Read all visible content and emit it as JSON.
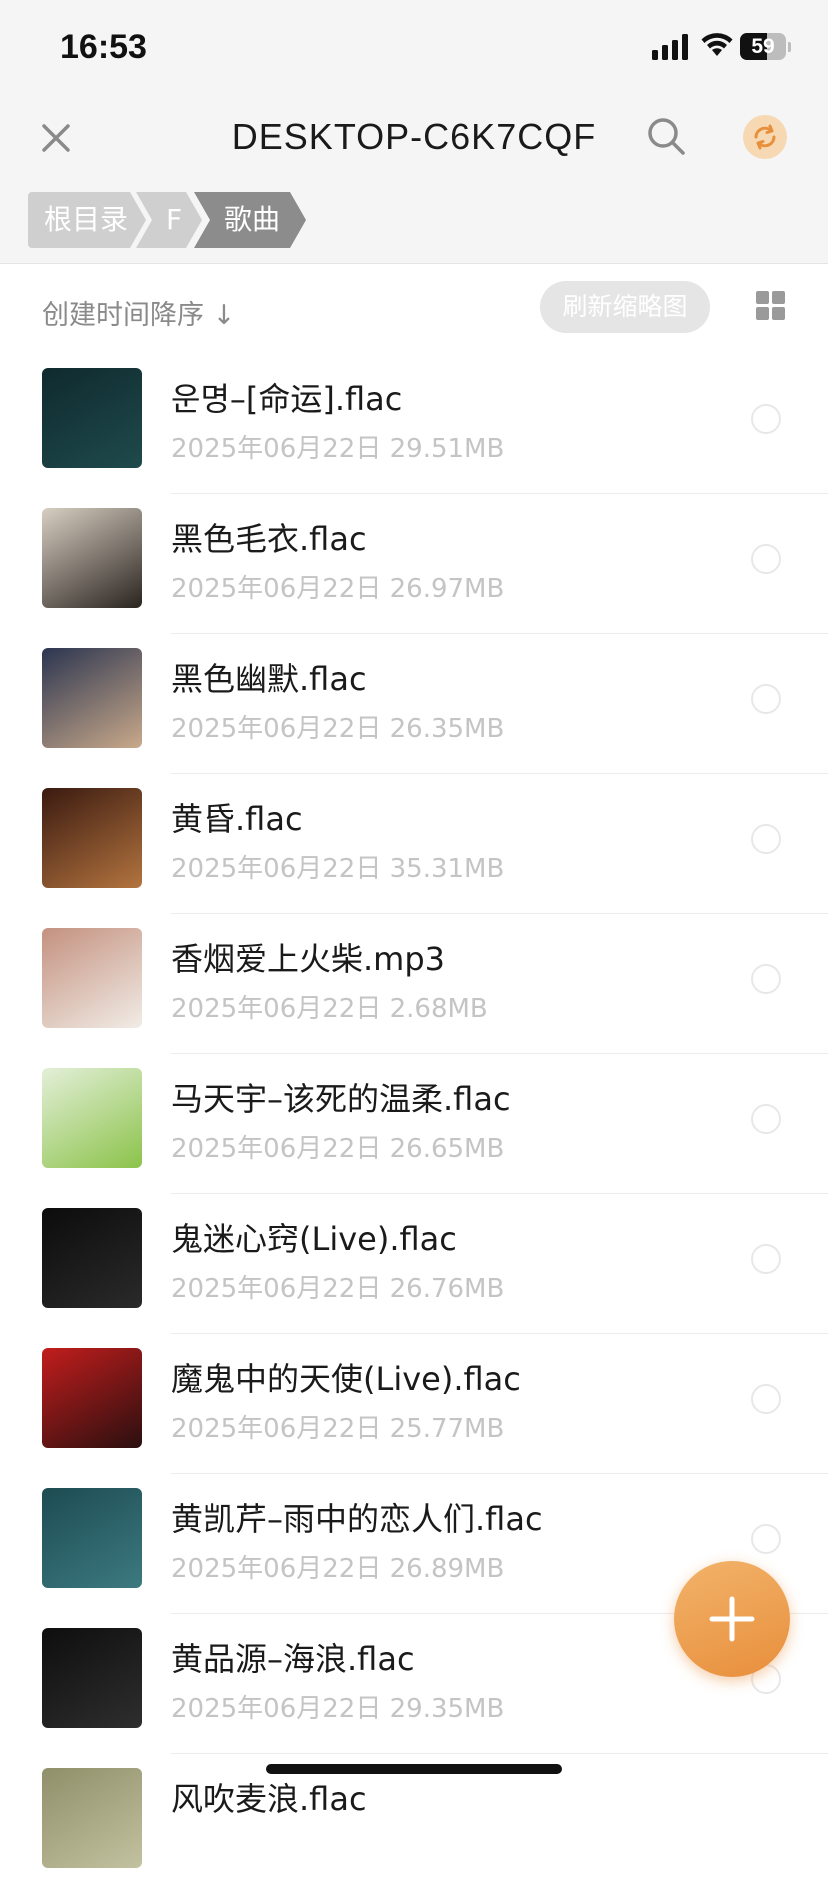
{
  "status_bar": {
    "time": "16:53",
    "battery_level": "59",
    "battery_fraction": 0.59
  },
  "header": {
    "title": "DESKTOP-C6K7CQF",
    "breadcrumb": [
      "根目录",
      "F",
      "歌曲"
    ],
    "accent_color": "#E88F3C"
  },
  "toolbar": {
    "sort_label": "创建时间降序 ↓",
    "refresh_thumbs_label": "刷新缩略图"
  },
  "files": [
    {
      "name": "운명–[命运].flac",
      "date": "2025年06月22日",
      "size": "29.51MB",
      "thumb_colors": [
        "#0f2a2e",
        "#1f4a4c"
      ]
    },
    {
      "name": "黑色毛衣.flac",
      "date": "2025年06月22日",
      "size": "26.97MB",
      "thumb_colors": [
        "#d8cfc2",
        "#2a2420"
      ]
    },
    {
      "name": "黑色幽默.flac",
      "date": "2025年06月22日",
      "size": "26.35MB",
      "thumb_colors": [
        "#2b3550",
        "#c9a98a"
      ]
    },
    {
      "name": "黄昏.flac",
      "date": "2025年06月22日",
      "size": "35.31MB",
      "thumb_colors": [
        "#3a1a10",
        "#b3743f"
      ]
    },
    {
      "name": "香烟爱上火柴.mp3",
      "date": "2025年06月22日",
      "size": "2.68MB",
      "thumb_colors": [
        "#c4917f",
        "#f1ece6"
      ]
    },
    {
      "name": "马天宇–该死的温柔.flac",
      "date": "2025年06月22日",
      "size": "26.65MB",
      "thumb_colors": [
        "#e3efd8",
        "#8bc34a"
      ]
    },
    {
      "name": "鬼迷心窍(Live).flac",
      "date": "2025年06月22日",
      "size": "26.76MB",
      "thumb_colors": [
        "#0c0c0c",
        "#2a2a2a"
      ]
    },
    {
      "name": "魔鬼中的天使(Live).flac",
      "date": "2025年06月22日",
      "size": "25.77MB",
      "thumb_colors": [
        "#c21d1d",
        "#2a0f0f"
      ]
    },
    {
      "name": "黄凯芹–雨中的恋人们.flac",
      "date": "2025年06月22日",
      "size": "26.89MB",
      "thumb_colors": [
        "#1d4b52",
        "#3c7a80"
      ]
    },
    {
      "name": "黄品源–海浪.flac",
      "date": "2025年06月22日",
      "size": "29.35MB",
      "thumb_colors": [
        "#0e0e0e",
        "#2e2e2e"
      ]
    },
    {
      "name": "风吹麦浪.flac",
      "date": "",
      "size": "",
      "thumb_colors": [
        "#8f8f6a",
        "#c2c2a0"
      ]
    }
  ],
  "icons": {
    "close": "close-icon",
    "search": "search-icon",
    "sync": "sync-icon",
    "grid": "grid-view-icon",
    "add": "plus-icon"
  }
}
